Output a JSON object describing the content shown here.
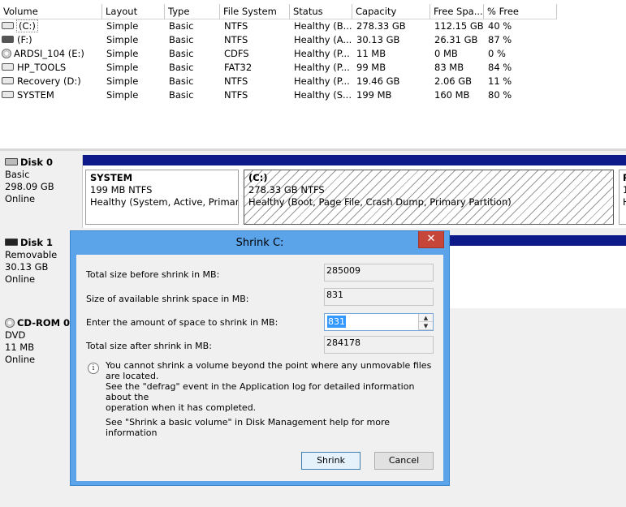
{
  "columns": [
    "Volume",
    "Layout",
    "Type",
    "File System",
    "Status",
    "Capacity",
    "Free Spa...",
    "% Free"
  ],
  "volumes": [
    {
      "name": "(C:)",
      "layout": "Simple",
      "type": "Basic",
      "fs": "NTFS",
      "status": "Healthy (B...",
      "capacity": "278.33 GB",
      "free": "112.15 GB",
      "pct": "40 %",
      "icon": "drive-icon"
    },
    {
      "name": "(F:)",
      "layout": "Simple",
      "type": "Basic",
      "fs": "NTFS",
      "status": "Healthy (A...",
      "capacity": "30.13 GB",
      "free": "26.31 GB",
      "pct": "87 %",
      "icon": "drive-icon"
    },
    {
      "name": "ARDSI_104 (E:)",
      "layout": "Simple",
      "type": "Basic",
      "fs": "CDFS",
      "status": "Healthy (P...",
      "capacity": "11 MB",
      "free": "0 MB",
      "pct": "0 %",
      "icon": "cd-icon"
    },
    {
      "name": "HP_TOOLS",
      "layout": "Simple",
      "type": "Basic",
      "fs": "FAT32",
      "status": "Healthy (P...",
      "capacity": "99 MB",
      "free": "83 MB",
      "pct": "84 %",
      "icon": "drive-icon"
    },
    {
      "name": "Recovery (D:)",
      "layout": "Simple",
      "type": "Basic",
      "fs": "NTFS",
      "status": "Healthy (P...",
      "capacity": "19.46 GB",
      "free": "2.06 GB",
      "pct": "11 %",
      "icon": "drive-icon"
    },
    {
      "name": "SYSTEM",
      "layout": "Simple",
      "type": "Basic",
      "fs": "NTFS",
      "status": "Healthy (S...",
      "capacity": "199 MB",
      "free": "160 MB",
      "pct": "80 %",
      "icon": "drive-icon"
    }
  ],
  "disks": {
    "disk0": {
      "title": "Disk 0",
      "type": "Basic",
      "size": "298.09 GB",
      "state": "Online"
    },
    "disk1": {
      "title": "Disk 1",
      "type": "Removable",
      "size": "30.13 GB",
      "state": "Online"
    },
    "cdrom0": {
      "title": "CD-ROM 0",
      "type": "DVD",
      "size": "11 MB",
      "state": "Online"
    }
  },
  "partitions": {
    "system": {
      "name": "SYSTEM",
      "size": "199 MB NTFS",
      "status": "Healthy (System, Active, Primary P"
    },
    "c": {
      "name": "(C:)",
      "size": "278.33 GB NTFS",
      "status": "Healthy (Boot, Page File, Crash Dump, Primary Partition)"
    },
    "r": {
      "name": "R",
      "size": "1",
      "status": "H"
    }
  },
  "dialog": {
    "title": "Shrink C:",
    "close": "✕",
    "total_before_label": "Total size before shrink in MB:",
    "total_before_value": "285009",
    "available_label": "Size of available shrink space in MB:",
    "available_value": "831",
    "amount_label": "Enter the amount of space to shrink in MB:",
    "amount_value": "831",
    "total_after_label": "Total size after shrink in MB:",
    "total_after_value": "284178",
    "info_line1": "You cannot shrink a volume beyond the point where any unmovable files are located.",
    "info_line2": "See the \"defrag\" event in the Application log for detailed information about the",
    "info_line3": "operation when it has completed.",
    "help": "See \"Shrink a basic volume\" in Disk Management help for more information",
    "shrink_button": "Shrink",
    "cancel_button": "Cancel",
    "spin_up": "▲",
    "spin_down": "▼",
    "info_glyph": "i"
  }
}
